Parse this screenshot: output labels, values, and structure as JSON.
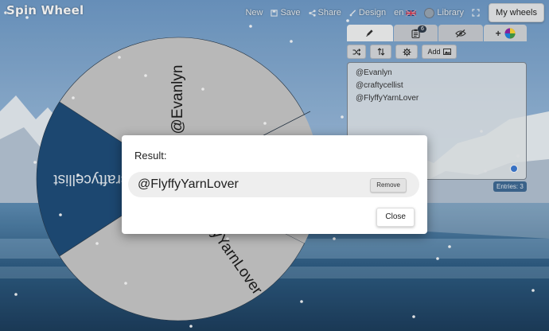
{
  "app": {
    "logo": "Spin Wheel"
  },
  "nav": {
    "new": "New",
    "save": "Save",
    "share": "Share",
    "design": "Design",
    "language": "en",
    "library": "Library",
    "my_wheels": "My wheels"
  },
  "wheel": {
    "slices": [
      {
        "label": "@Evanlyn",
        "color": "#c8c8c8"
      },
      {
        "label": "@craftycellist",
        "color": "#1f4e7a"
      },
      {
        "label": "@FlyffyYarnLover",
        "color": "#c8c8c8"
      }
    ]
  },
  "panel": {
    "tab_edit_icon": "pencil-icon",
    "tab_results_badge": "6",
    "add_image_label": "Add",
    "entries": [
      "@Evanlyn",
      "@craftycellist",
      "@FlyffyYarnLover"
    ],
    "entries_count": "Entries: 3"
  },
  "dialog": {
    "title": "Result:",
    "result": "@FlyffyYarnLover",
    "remove_label": "Remove",
    "close_label": "Close"
  },
  "colors": {
    "wheel_gray": "#c8c8c8",
    "wheel_blue": "#1f4e7a",
    "sky": "#7fa7cc",
    "sea": "#2f5f86"
  }
}
